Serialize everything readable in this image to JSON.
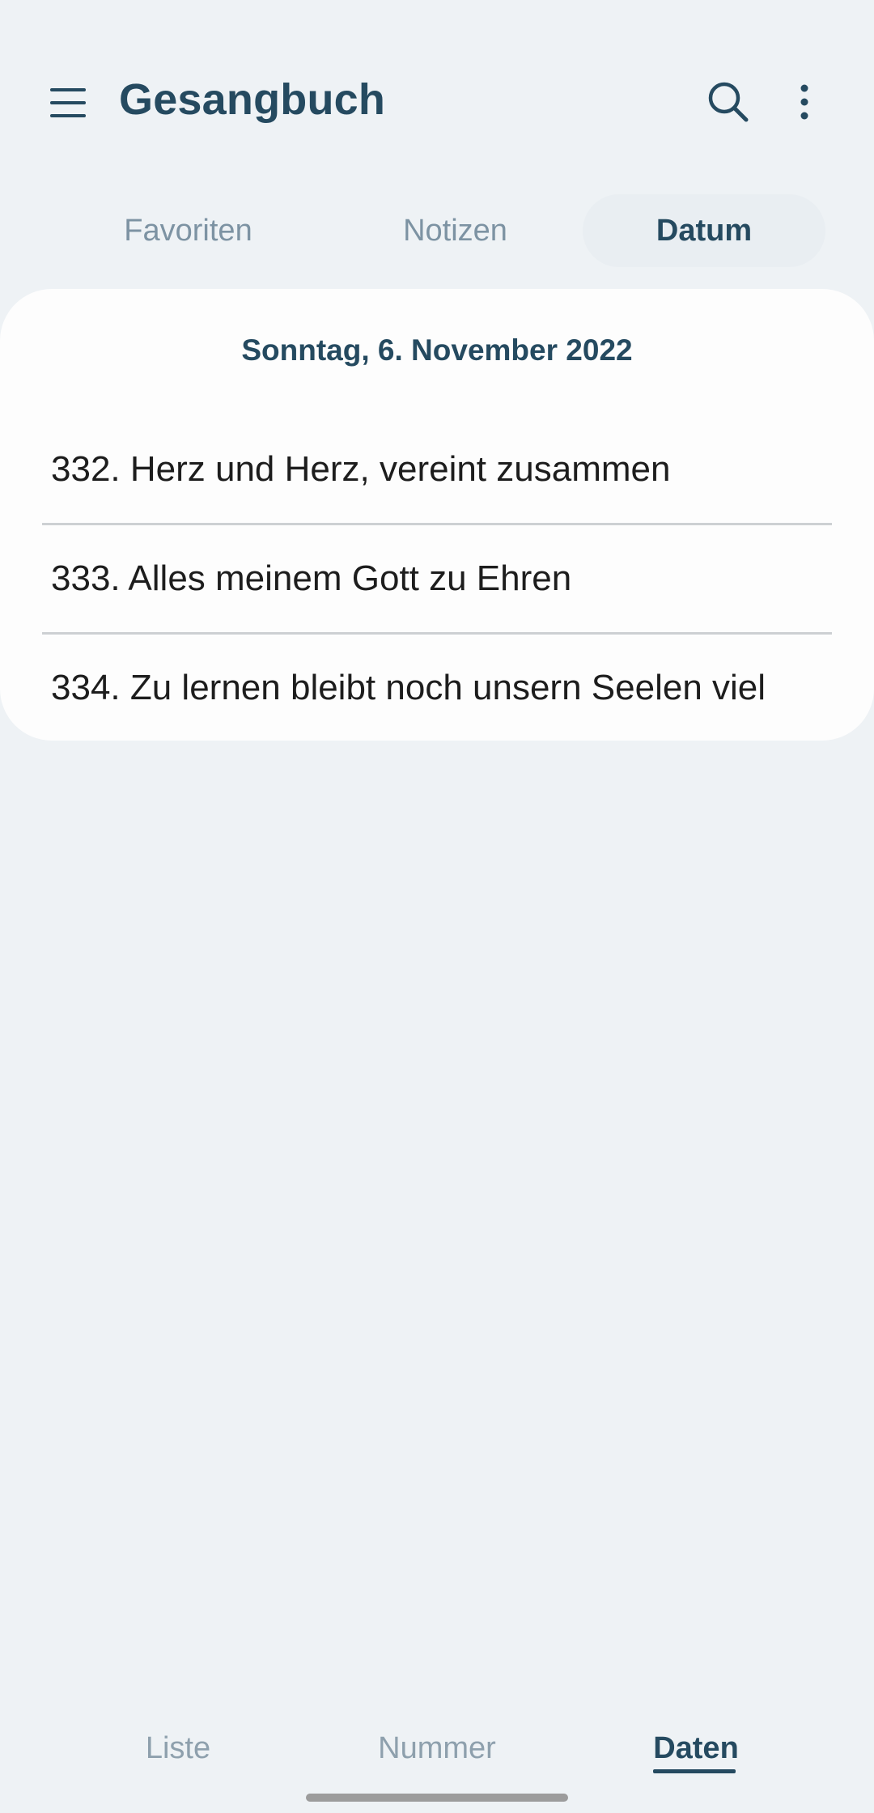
{
  "app_bar": {
    "title": "Gesangbuch",
    "icons": [
      "menu-icon",
      "search-icon",
      "more-vert-icon"
    ]
  },
  "top_tabs": [
    {
      "label": "Favoriten",
      "selected": false
    },
    {
      "label": "Notizen",
      "selected": false
    },
    {
      "label": "Datum",
      "selected": true
    }
  ],
  "list": {
    "date": "Sonntag, 6. November 2022",
    "items": [
      "332. Herz und Herz, vereint zusammen",
      "333. Alles meinem Gott zu Ehren",
      "334. Zu lernen bleibt noch unsern Seelen viel"
    ]
  },
  "bottom_nav": [
    {
      "label": "Liste",
      "selected": false
    },
    {
      "label": "Nummer",
      "selected": false
    },
    {
      "label": "Daten",
      "selected": true
    }
  ],
  "colors": {
    "background": "#eef2f5",
    "accent": "#254a60",
    "muted": "#7d93a3",
    "card": "#fdfdfd"
  }
}
